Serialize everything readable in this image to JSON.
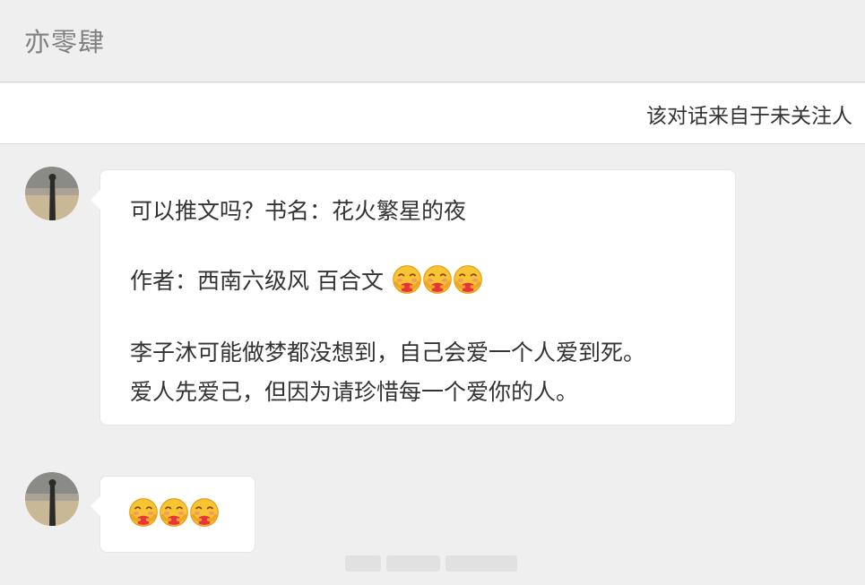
{
  "header": {
    "title": "亦零肆"
  },
  "notice": {
    "text": "该对话来自于未关注人"
  },
  "messages": [
    {
      "lines": [
        "可以推文吗？书名：花火繁星的夜",
        "作者：西南六级风 百合文",
        "李子沐可能做梦都没想到，自己会爱一个人爱到死。",
        "爱人先爱己，但因为请珍惜每一个爱你的人。"
      ],
      "emoji": "hug-emoji",
      "emoji_count": 3
    },
    {
      "lines": [],
      "emoji": "hug-emoji",
      "emoji_count": 3
    }
  ],
  "colors": {
    "background": "#efefef",
    "bubble": "#ffffff",
    "title": "#808080",
    "text": "#333333"
  }
}
